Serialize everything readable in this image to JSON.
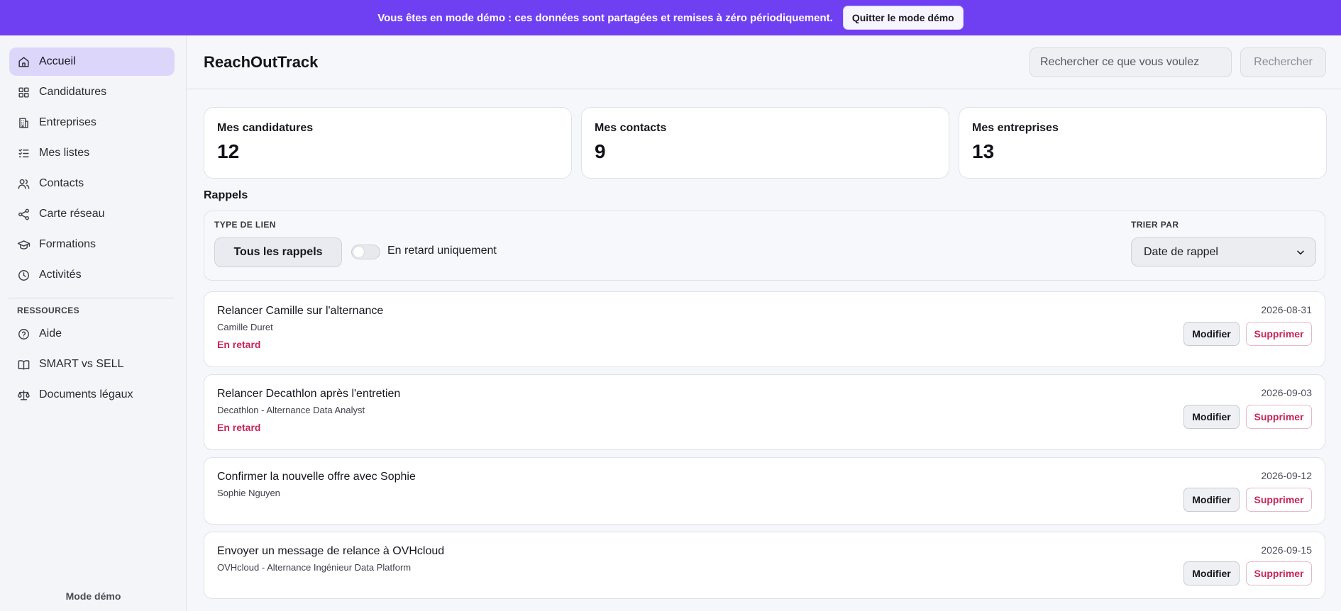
{
  "banner": {
    "text": "Vous êtes en mode démo : ces données sont partagées et remises à zéro périodiquement.",
    "quit_label": "Quitter le mode démo",
    "color": "#6f3ff2"
  },
  "sidebar": {
    "items": [
      {
        "label": "Accueil",
        "icon": "home-icon",
        "active": true
      },
      {
        "label": "Candidatures",
        "icon": "grid-icon"
      },
      {
        "label": "Entreprises",
        "icon": "building-icon"
      },
      {
        "label": "Mes listes",
        "icon": "checklist-icon"
      },
      {
        "label": "Contacts",
        "icon": "users-icon"
      },
      {
        "label": "Carte réseau",
        "icon": "share-icon"
      },
      {
        "label": "Formations",
        "icon": "graduation-cap-icon"
      },
      {
        "label": "Activités",
        "icon": "clock-icon"
      }
    ],
    "resources_title": "RESSOURCES",
    "resources": [
      {
        "label": "Aide",
        "icon": "help-icon"
      },
      {
        "label": "SMART vs SELL",
        "icon": "book-icon"
      },
      {
        "label": "Documents légaux",
        "icon": "scale-icon"
      }
    ],
    "footer": "Mode démo"
  },
  "header": {
    "title": "ReachOutTrack",
    "search_placeholder": "Rechercher ce que vous voulez",
    "search_button": "Rechercher"
  },
  "stats": [
    {
      "label": "Mes candidatures",
      "value": "12"
    },
    {
      "label": "Mes contacts",
      "value": "9"
    },
    {
      "label": "Mes entreprises",
      "value": "13"
    }
  ],
  "reminders_section": {
    "title": "Rappels",
    "filter_type_label": "TYPE DE LIEN",
    "filter_type_value": "Tous les rappels",
    "overdue_toggle_label": "En retard uniquement",
    "overdue_toggle_on": false,
    "sort_label": "TRIER PAR",
    "sort_value": "Date de rappel"
  },
  "reminders": [
    {
      "title": "Relancer Camille sur l'alternance",
      "subtitle": "Camille Duret",
      "status": "En retard",
      "date": "2026-08-31"
    },
    {
      "title": "Relancer Decathlon après l'entretien",
      "subtitle": "Decathlon - Alternance Data Analyst",
      "status": "En retard",
      "date": "2026-09-03"
    },
    {
      "title": "Confirmer la nouvelle offre avec Sophie",
      "subtitle": "Sophie Nguyen",
      "status": "",
      "date": "2026-09-12"
    },
    {
      "title": "Envoyer un message de relance à OVHcloud",
      "subtitle": "OVHcloud - Alternance Ingénieur Data Platform",
      "status": "",
      "date": "2026-09-15"
    }
  ],
  "actions": {
    "edit": "Modifier",
    "delete": "Supprimer"
  }
}
